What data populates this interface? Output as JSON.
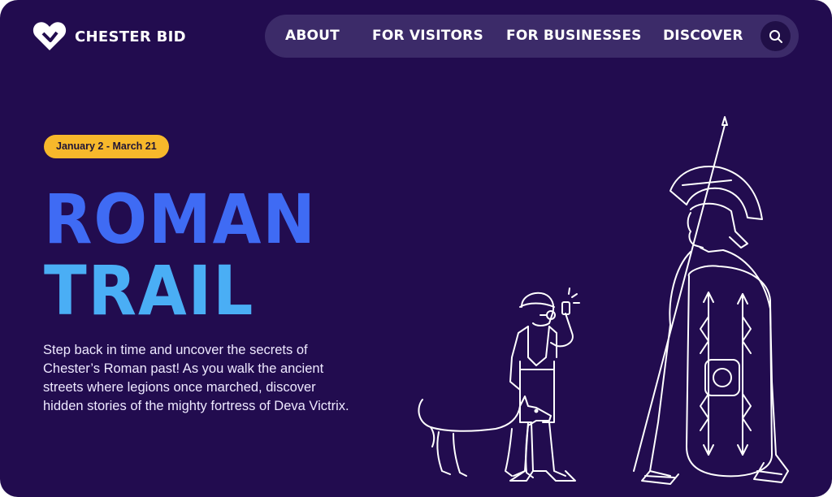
{
  "brand": {
    "name": "CHESTER BID",
    "logo_icon": "heart-icon"
  },
  "nav": {
    "items": [
      {
        "label": "ABOUT"
      },
      {
        "label": "FOR VISITORS"
      },
      {
        "label": "FOR BUSINESSES"
      },
      {
        "label": "DISCOVER"
      }
    ],
    "search_icon": "search-icon"
  },
  "hero": {
    "date_badge": "January 2 - March 21",
    "title_line1": "ROMAN",
    "title_line2": "TRAIL",
    "description": "Step back in time and uncover the secrets of Chester’s Roman past! As you walk the ancient streets where legions once marched, discover hidden stories of the mighty fortress of Deva Victrix."
  },
  "colors": {
    "background": "#220c4f",
    "nav_background": "#3c2b69",
    "badge": "#f7b82b",
    "title_blue": "#3f6bf4",
    "title_light_blue": "#4aaef5"
  },
  "illustration": {
    "subject": "roman-soldier-and-visitor-with-dog"
  }
}
